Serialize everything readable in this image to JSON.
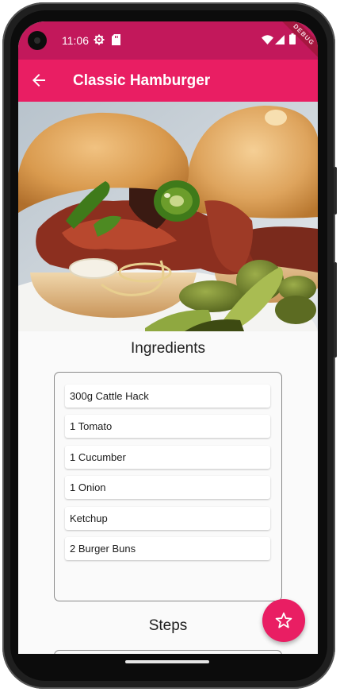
{
  "status_bar": {
    "time": "11:06",
    "debug_banner": "DEBUG"
  },
  "app_bar": {
    "title": "Classic Hamburger"
  },
  "ingredients": {
    "heading": "Ingredients",
    "items": [
      "300g Cattle Hack",
      "1 Tomato",
      "1 Cucumber",
      "1 Onion",
      "Ketchup",
      "2 Burger Buns"
    ]
  },
  "steps": {
    "heading": "Steps"
  },
  "colors": {
    "status_bar": "#c2185b",
    "app_bar": "#e91e63",
    "fab": "#e91e63"
  },
  "icons": {
    "back": "arrow-back-icon",
    "fab": "star-outline-icon"
  }
}
